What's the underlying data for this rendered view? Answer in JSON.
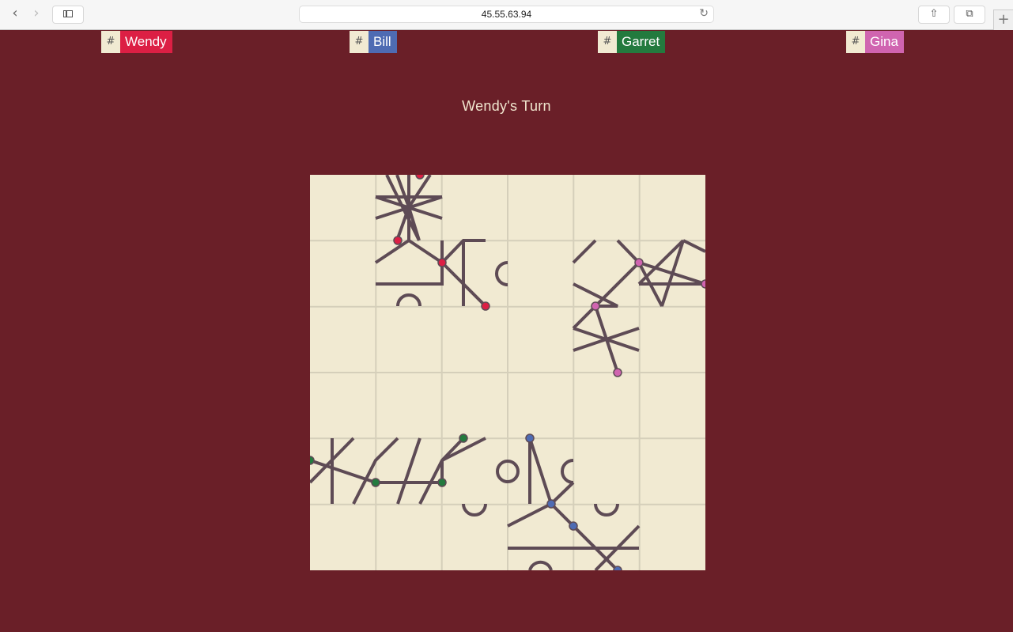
{
  "browser": {
    "url": "45.55.63.94",
    "back_icon": "chevron-left-icon",
    "forward_icon": "chevron-right-icon"
  },
  "players": [
    {
      "hash": "#",
      "name": "Wendy",
      "color": "#dc1f44"
    },
    {
      "hash": "#",
      "name": "Bill",
      "color": "#4e6bb3"
    },
    {
      "hash": "#",
      "name": "Garret",
      "color": "#237a3e"
    },
    {
      "hash": "#",
      "name": "Gina",
      "color": "#d064b0"
    }
  ],
  "status": {
    "turn_text": "Wendy's Turn"
  },
  "colors": {
    "background": "#6a1f28",
    "board": "#f1ead2",
    "grid": "#d5cfba",
    "track": "#5e4b55"
  },
  "board": {
    "grid_size": 6
  }
}
